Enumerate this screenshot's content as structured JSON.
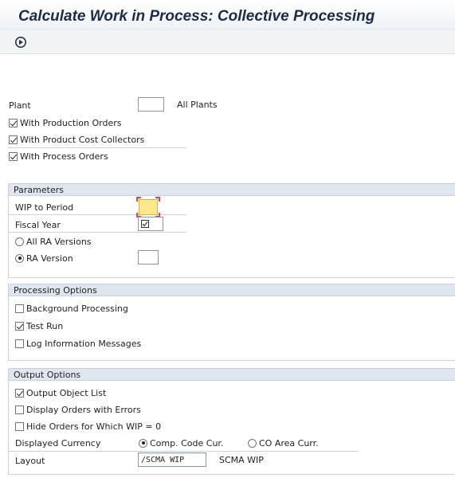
{
  "title": "Calculate Work in Process: Collective Processing",
  "toolbar": {
    "execute_icon": "execute-icon"
  },
  "selection": {
    "plant_label": "Plant",
    "plant_value": "",
    "plant_note": "All Plants",
    "production_orders_label": "With Production Orders",
    "production_orders_checked": true,
    "cost_collectors_label": "With Product Cost Collectors",
    "cost_collectors_checked": true,
    "process_orders_label": "With Process Orders",
    "process_orders_checked": true
  },
  "parameters": {
    "header": "Parameters",
    "wip_period_label": "WIP to Period",
    "wip_period_value": "",
    "fiscal_year_label": "Fiscal Year",
    "fiscal_year_value": "",
    "all_ra_versions_label": "All RA Versions",
    "ra_version_label": "RA Version",
    "ra_version_value": "",
    "selected_ra_option": "RA Version"
  },
  "processing": {
    "header": "Processing Options",
    "background_label": "Background Processing",
    "background_checked": false,
    "test_run_label": "Test Run",
    "test_run_checked": true,
    "log_info_label": "Log Information Messages",
    "log_info_checked": false
  },
  "output": {
    "header": "Output Options",
    "object_list_label": "Output Object List",
    "object_list_checked": true,
    "errors_label": "Display Orders with Errors",
    "errors_checked": false,
    "hide_label": "Hide Orders for Which WIP = 0",
    "hide_checked": false,
    "currency_label": "Displayed Currency",
    "comp_code_label": "Comp. Code Cur.",
    "co_area_label": "CO Area Curr.",
    "selected_currency": "Comp. Code Cur.",
    "layout_label": "Layout",
    "layout_value": "/SCMA WIP",
    "layout_text": "SCMA WIP"
  }
}
